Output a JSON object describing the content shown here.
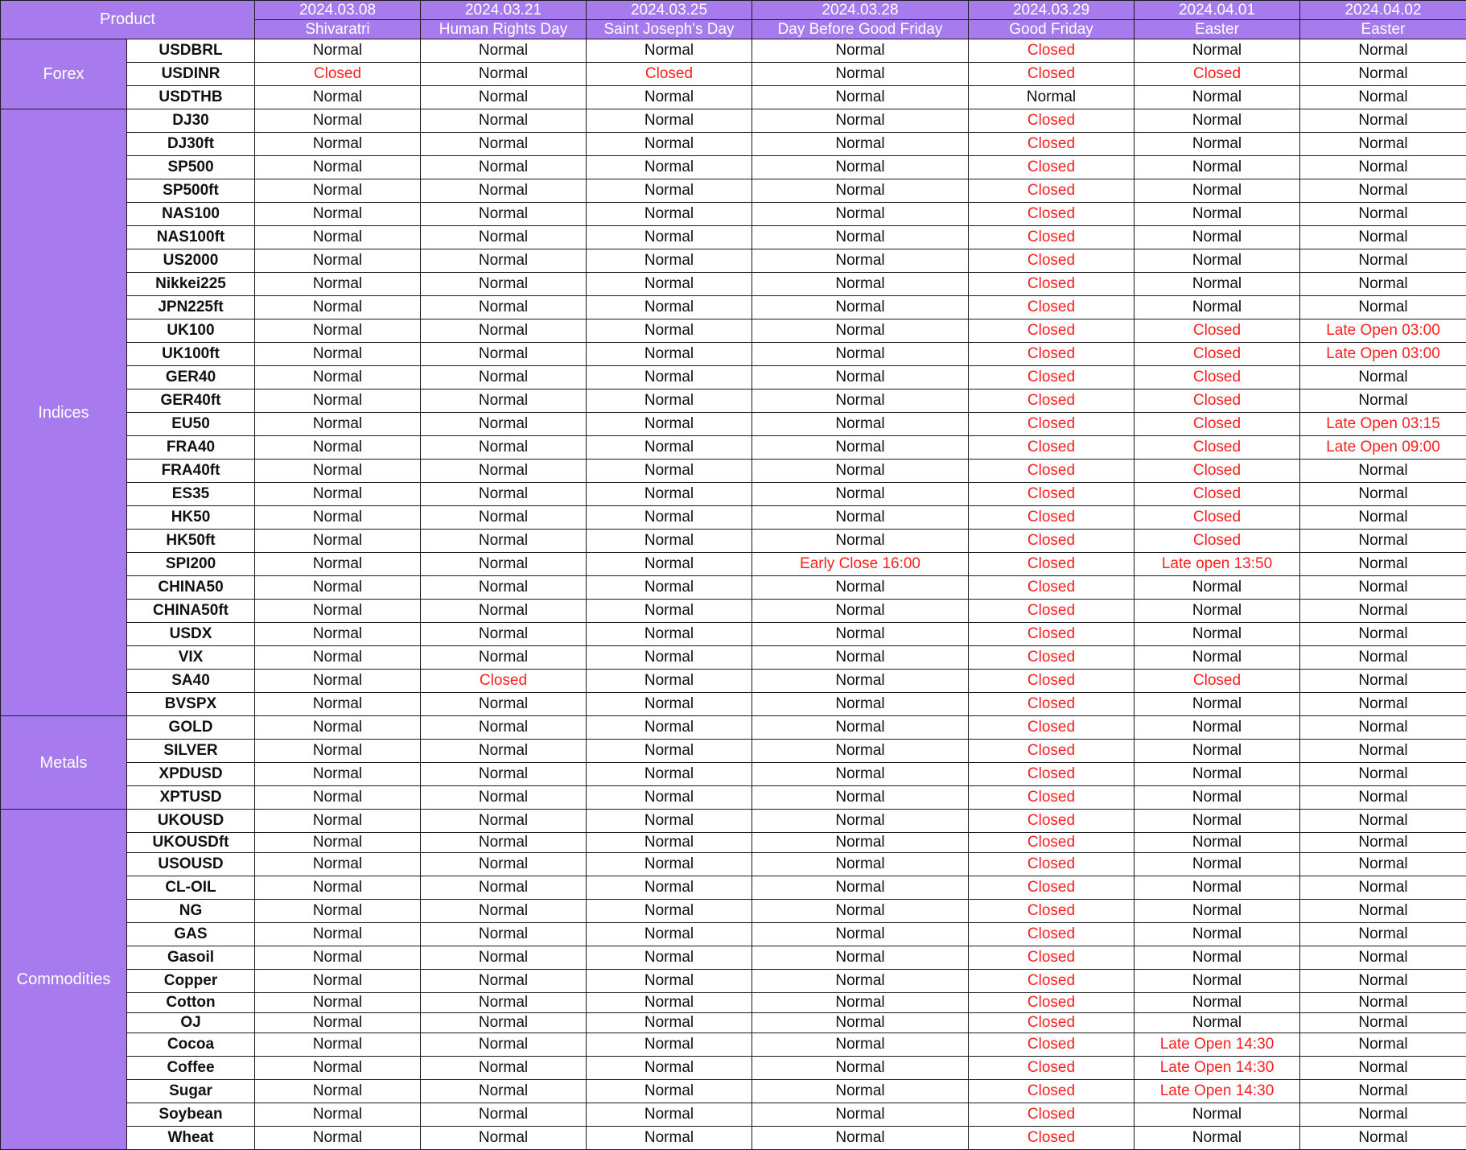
{
  "header": {
    "product_label": "Product",
    "columns": [
      {
        "date": "2024.03.08",
        "holiday": "Shivaratri"
      },
      {
        "date": "2024.03.21",
        "holiday": "Human Rights Day"
      },
      {
        "date": "2024.03.25",
        "holiday": "Saint Joseph's Day"
      },
      {
        "date": "2024.03.28",
        "holiday": "Day Before Good Friday"
      },
      {
        "date": "2024.03.29",
        "holiday": "Good Friday"
      },
      {
        "date": "2024.04.01",
        "holiday": "Easter"
      },
      {
        "date": "2024.04.02",
        "holiday": "Easter"
      }
    ]
  },
  "colors": {
    "header_bg": "#a77bee",
    "header_text": "#ffffff",
    "normal_text": "#111111",
    "alert_text": "#ff1e1e",
    "border": "#1a1a1a"
  },
  "groups": [
    {
      "category": "Forex",
      "rows": [
        {
          "product": "USDBRL",
          "values": [
            "Normal",
            "Normal",
            "Normal",
            "Normal",
            "Closed",
            "Normal",
            "Normal"
          ]
        },
        {
          "product": "USDINR",
          "values": [
            "Closed",
            "Normal",
            "Closed",
            "Normal",
            "Closed",
            "Closed",
            "Normal"
          ]
        },
        {
          "product": "USDTHB",
          "values": [
            "Normal",
            "Normal",
            "Normal",
            "Normal",
            "Normal",
            "Normal",
            "Normal"
          ]
        }
      ]
    },
    {
      "category": "Indices",
      "rows": [
        {
          "product": "DJ30",
          "values": [
            "Normal",
            "Normal",
            "Normal",
            "Normal",
            "Closed",
            "Normal",
            "Normal"
          ]
        },
        {
          "product": "DJ30ft",
          "values": [
            "Normal",
            "Normal",
            "Normal",
            "Normal",
            "Closed",
            "Normal",
            "Normal"
          ]
        },
        {
          "product": "SP500",
          "values": [
            "Normal",
            "Normal",
            "Normal",
            "Normal",
            "Closed",
            "Normal",
            "Normal"
          ]
        },
        {
          "product": "SP500ft",
          "values": [
            "Normal",
            "Normal",
            "Normal",
            "Normal",
            "Closed",
            "Normal",
            "Normal"
          ]
        },
        {
          "product": "NAS100",
          "values": [
            "Normal",
            "Normal",
            "Normal",
            "Normal",
            "Closed",
            "Normal",
            "Normal"
          ]
        },
        {
          "product": "NAS100ft",
          "values": [
            "Normal",
            "Normal",
            "Normal",
            "Normal",
            "Closed",
            "Normal",
            "Normal"
          ]
        },
        {
          "product": "US2000",
          "values": [
            "Normal",
            "Normal",
            "Normal",
            "Normal",
            "Closed",
            "Normal",
            "Normal"
          ]
        },
        {
          "product": "Nikkei225",
          "values": [
            "Normal",
            "Normal",
            "Normal",
            "Normal",
            "Closed",
            "Normal",
            "Normal"
          ]
        },
        {
          "product": "JPN225ft",
          "values": [
            "Normal",
            "Normal",
            "Normal",
            "Normal",
            "Closed",
            "Normal",
            "Normal"
          ]
        },
        {
          "product": "UK100",
          "values": [
            "Normal",
            "Normal",
            "Normal",
            "Normal",
            "Closed",
            "Closed",
            "Late Open 03:00"
          ]
        },
        {
          "product": "UK100ft",
          "values": [
            "Normal",
            "Normal",
            "Normal",
            "Normal",
            "Closed",
            "Closed",
            "Late Open 03:00"
          ]
        },
        {
          "product": "GER40",
          "values": [
            "Normal",
            "Normal",
            "Normal",
            "Normal",
            "Closed",
            "Closed",
            "Normal"
          ]
        },
        {
          "product": "GER40ft",
          "values": [
            "Normal",
            "Normal",
            "Normal",
            "Normal",
            "Closed",
            "Closed",
            "Normal"
          ]
        },
        {
          "product": "EU50",
          "values": [
            "Normal",
            "Normal",
            "Normal",
            "Normal",
            "Closed",
            "Closed",
            "Late Open 03:15"
          ]
        },
        {
          "product": "FRA40",
          "values": [
            "Normal",
            "Normal",
            "Normal",
            "Normal",
            "Closed",
            "Closed",
            "Late Open 09:00"
          ]
        },
        {
          "product": "FRA40ft",
          "values": [
            "Normal",
            "Normal",
            "Normal",
            "Normal",
            "Closed",
            "Closed",
            "Normal"
          ]
        },
        {
          "product": "ES35",
          "values": [
            "Normal",
            "Normal",
            "Normal",
            "Normal",
            "Closed",
            "Closed",
            "Normal"
          ]
        },
        {
          "product": "HK50",
          "values": [
            "Normal",
            "Normal",
            "Normal",
            "Normal",
            "Closed",
            "Closed",
            "Normal"
          ]
        },
        {
          "product": "HK50ft",
          "values": [
            "Normal",
            "Normal",
            "Normal",
            "Normal",
            "Closed",
            "Closed",
            "Normal"
          ]
        },
        {
          "product": "SPI200",
          "values": [
            "Normal",
            "Normal",
            "Normal",
            "Early Close 16:00",
            "Closed",
            "Late open 13:50",
            "Normal"
          ]
        },
        {
          "product": "CHINA50",
          "values": [
            "Normal",
            "Normal",
            "Normal",
            "Normal",
            "Closed",
            "Normal",
            "Normal"
          ]
        },
        {
          "product": "CHINA50ft",
          "values": [
            "Normal",
            "Normal",
            "Normal",
            "Normal",
            "Closed",
            "Normal",
            "Normal"
          ]
        },
        {
          "product": "USDX",
          "values": [
            "Normal",
            "Normal",
            "Normal",
            "Normal",
            "Closed",
            "Normal",
            "Normal"
          ]
        },
        {
          "product": "VIX",
          "values": [
            "Normal",
            "Normal",
            "Normal",
            "Normal",
            "Closed",
            "Normal",
            "Normal"
          ]
        },
        {
          "product": "SA40",
          "values": [
            "Normal",
            "Closed",
            "Normal",
            "Normal",
            "Closed",
            "Closed",
            "Normal"
          ]
        },
        {
          "product": "BVSPX",
          "values": [
            "Normal",
            "Normal",
            "Normal",
            "Normal",
            "Closed",
            "Normal",
            "Normal"
          ]
        }
      ]
    },
    {
      "category": "Metals",
      "rows": [
        {
          "product": "GOLD",
          "values": [
            "Normal",
            "Normal",
            "Normal",
            "Normal",
            "Closed",
            "Normal",
            "Normal"
          ]
        },
        {
          "product": "SILVER",
          "values": [
            "Normal",
            "Normal",
            "Normal",
            "Normal",
            "Closed",
            "Normal",
            "Normal"
          ]
        },
        {
          "product": "XPDUSD",
          "values": [
            "Normal",
            "Normal",
            "Normal",
            "Normal",
            "Closed",
            "Normal",
            "Normal"
          ]
        },
        {
          "product": "XPTUSD",
          "values": [
            "Normal",
            "Normal",
            "Normal",
            "Normal",
            "Closed",
            "Normal",
            "Normal"
          ]
        }
      ]
    },
    {
      "category": "Commodities",
      "rows": [
        {
          "product": "UKOUSD",
          "values": [
            "Normal",
            "Normal",
            "Normal",
            "Normal",
            "Closed",
            "Normal",
            "Normal"
          ]
        },
        {
          "product": "UKOUSDft",
          "values": [
            "Normal",
            "Normal",
            "Normal",
            "Normal",
            "Closed",
            "Normal",
            "Normal"
          ],
          "short": true
        },
        {
          "product": "USOUSD",
          "values": [
            "Normal",
            "Normal",
            "Normal",
            "Normal",
            "Closed",
            "Normal",
            "Normal"
          ]
        },
        {
          "product": "CL-OIL",
          "values": [
            "Normal",
            "Normal",
            "Normal",
            "Normal",
            "Closed",
            "Normal",
            "Normal"
          ]
        },
        {
          "product": "NG",
          "values": [
            "Normal",
            "Normal",
            "Normal",
            "Normal",
            "Closed",
            "Normal",
            "Normal"
          ]
        },
        {
          "product": "GAS",
          "values": [
            "Normal",
            "Normal",
            "Normal",
            "Normal",
            "Closed",
            "Normal",
            "Normal"
          ]
        },
        {
          "product": "Gasoil",
          "values": [
            "Normal",
            "Normal",
            "Normal",
            "Normal",
            "Closed",
            "Normal",
            "Normal"
          ]
        },
        {
          "product": "Copper",
          "values": [
            "Normal",
            "Normal",
            "Normal",
            "Normal",
            "Closed",
            "Normal",
            "Normal"
          ]
        },
        {
          "product": "Cotton",
          "values": [
            "Normal",
            "Normal",
            "Normal",
            "Normal",
            "Closed",
            "Normal",
            "Normal"
          ],
          "short": true
        },
        {
          "product": "OJ",
          "values": [
            "Normal",
            "Normal",
            "Normal",
            "Normal",
            "Closed",
            "Normal",
            "Normal"
          ],
          "short": true
        },
        {
          "product": "Cocoa",
          "values": [
            "Normal",
            "Normal",
            "Normal",
            "Normal",
            "Closed",
            "Late Open 14:30",
            "Normal"
          ]
        },
        {
          "product": "Coffee",
          "values": [
            "Normal",
            "Normal",
            "Normal",
            "Normal",
            "Closed",
            "Late Open 14:30",
            "Normal"
          ]
        },
        {
          "product": "Sugar",
          "values": [
            "Normal",
            "Normal",
            "Normal",
            "Normal",
            "Closed",
            "Late Open 14:30",
            "Normal"
          ]
        },
        {
          "product": "Soybean",
          "values": [
            "Normal",
            "Normal",
            "Normal",
            "Normal",
            "Closed",
            "Normal",
            "Normal"
          ]
        },
        {
          "product": "Wheat",
          "values": [
            "Normal",
            "Normal",
            "Normal",
            "Normal",
            "Closed",
            "Normal",
            "Normal"
          ]
        }
      ]
    }
  ]
}
